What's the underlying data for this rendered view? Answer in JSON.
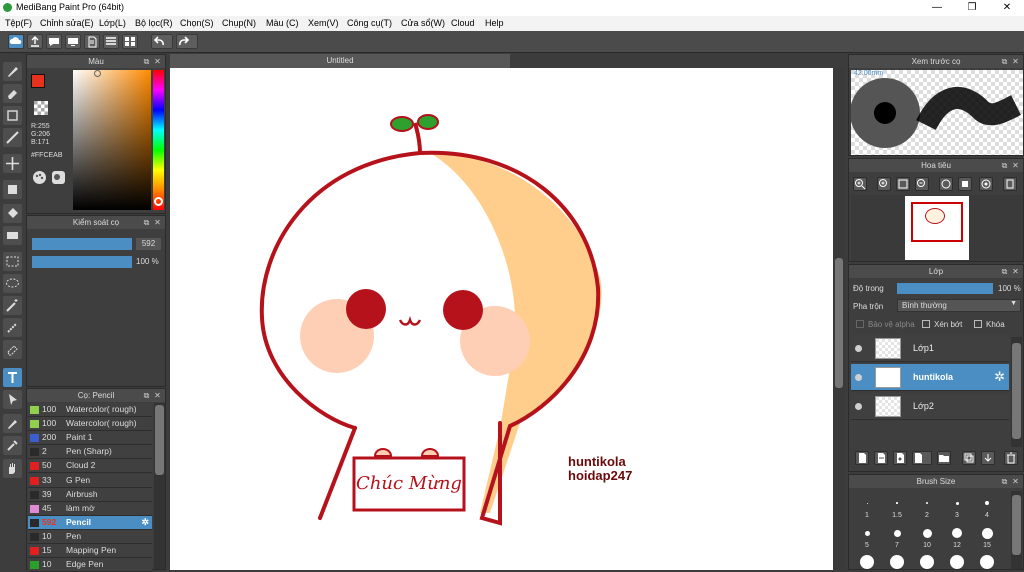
{
  "window": {
    "title": "MediBang Paint Pro (64bit)",
    "min": "—",
    "max": "❐",
    "close": "✕"
  },
  "menu": [
    "Tệp(F)",
    "Chỉnh sửa(E)",
    "Lớp(L)",
    "Bộ lọc(R)",
    "Chọn(S)",
    "Chụp(N)",
    "Màu (C)",
    "Xem(V)",
    "Công cụ(T)",
    "Cửa sổ(W)",
    "Cloud",
    "Help"
  ],
  "colors": {
    "accent": "#4a8ec4",
    "stroke": "#b5121b",
    "skin": "#ffce8c",
    "cheek": "#ffcfb5",
    "leaf": "#2ea02e"
  },
  "color_panel": {
    "title": "Màu",
    "r": "R:255",
    "g": "G:206",
    "b": "B:171",
    "hex": "#FFCEAB",
    "fg": "#e8321e",
    "bg": "#ffffff"
  },
  "brush_control": {
    "title": "Kiểm soát cọ",
    "size": "592",
    "opacity": "100 %"
  },
  "brush_list": {
    "title": "Cọ: Pencil",
    "items": [
      {
        "size": "100",
        "name": "Watercolor( rough)",
        "color": "#8fd14f"
      },
      {
        "size": "100",
        "name": "Watercolor( rough)",
        "color": "#8fd14f"
      },
      {
        "size": "200",
        "name": "Paint 1",
        "color": "#3a5fcd"
      },
      {
        "size": "2",
        "name": "Pen (Sharp)",
        "color": "#2a2a2a"
      },
      {
        "size": "50",
        "name": "Cloud 2",
        "color": "#e02020"
      },
      {
        "size": "33",
        "name": "G Pen",
        "color": "#e02020"
      },
      {
        "size": "39",
        "name": "Airbrush",
        "color": "#2a2a2a"
      },
      {
        "size": "45",
        "name": "làm mờ",
        "color": "#e08ad4"
      },
      {
        "size": "592",
        "name": "Pencil",
        "color": "#2a2a2a",
        "active": true
      },
      {
        "size": "10",
        "name": "Pen",
        "color": "#2a2a2a"
      },
      {
        "size": "15",
        "name": "Mapping Pen",
        "color": "#e02020"
      },
      {
        "size": "10",
        "name": "Edge Pen",
        "color": "#2aa02a"
      }
    ]
  },
  "canvas": {
    "tab": "Untitled",
    "text_line1": "huntikola",
    "text_line2": "hoidap247",
    "sign": "Chúc Mừng"
  },
  "preview": {
    "title": "Xem trước cọ",
    "size_label": "42.00mm"
  },
  "navigator": {
    "title": "Hoa tiêu"
  },
  "layers": {
    "title": "Lớp",
    "opacity_label": "Độ trong",
    "opacity_value": "100 %",
    "opacity": 1.0,
    "blend_label": "Pha trộn",
    "blend_value": "Bình thường",
    "protect_alpha": "Bảo vệ alpha",
    "clipping": "Xén bớt",
    "lock": "Khóa",
    "items": [
      {
        "name": "Lớp1"
      },
      {
        "name": "huntikola",
        "active": true
      },
      {
        "name": "Lớp2"
      }
    ]
  },
  "brush_size": {
    "title": "Brush Size",
    "labels": [
      "1",
      "1.5",
      "2",
      "3",
      "4",
      "5",
      "7",
      "10",
      "12",
      "15"
    ]
  }
}
